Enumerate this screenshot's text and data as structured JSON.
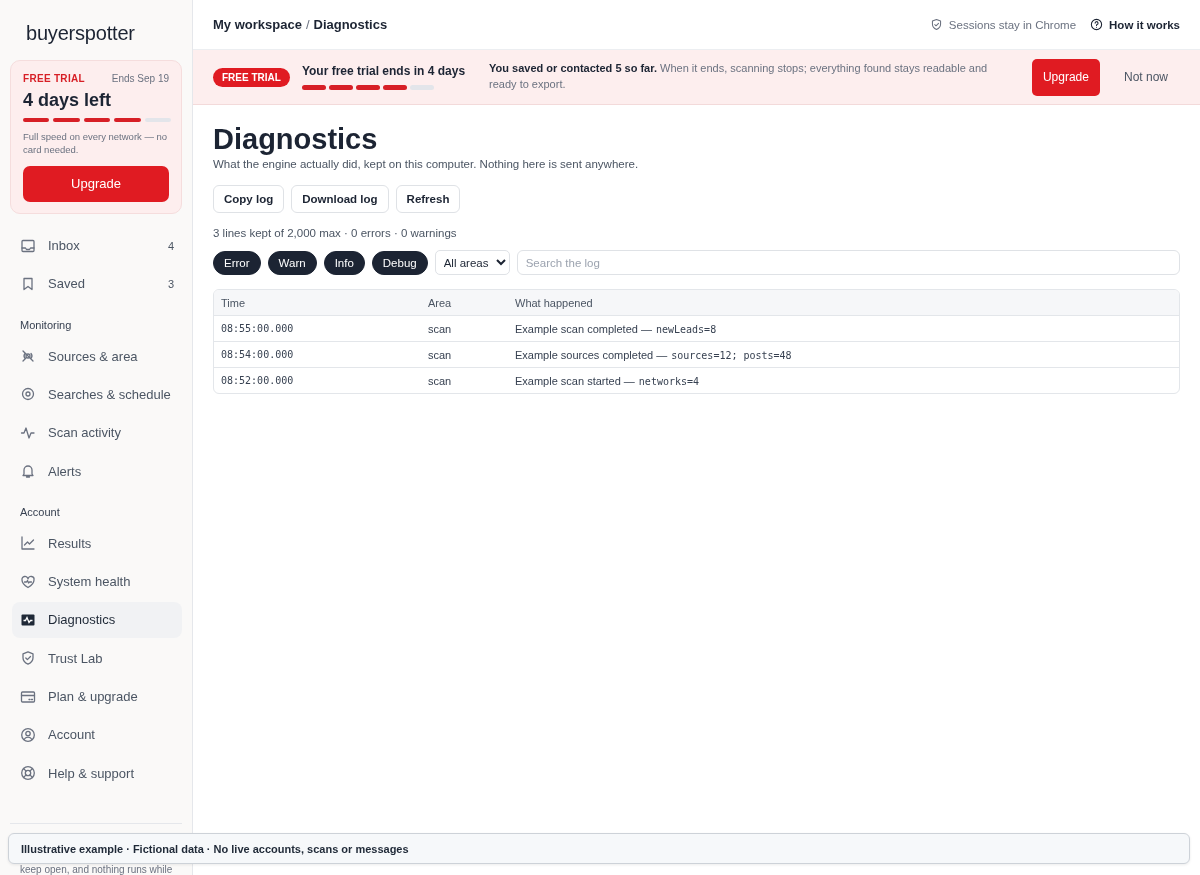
{
  "sidebar": {
    "logo": "buyerspotter",
    "trial_card": {
      "badge": "FREE TRIAL",
      "ends": "Ends Sep 19",
      "title": "4 days left",
      "level": 0.8,
      "note": "Full speed on every network — no card needed.",
      "button": "Upgrade"
    },
    "sections": [
      {
        "items": [
          {
            "label": "Inbox",
            "count": "4",
            "selected": false
          },
          {
            "label": "Saved",
            "count": "3",
            "selected": false
          }
        ]
      },
      {
        "heading": "Monitoring",
        "items": [
          {
            "label": "Sources & area",
            "selected": false
          },
          {
            "label": "Searches & schedule",
            "selected": false
          },
          {
            "label": "Scan activity",
            "selected": false
          },
          {
            "label": "Alerts",
            "selected": false
          }
        ]
      },
      {
        "heading": "Account",
        "items": [
          {
            "label": "Results",
            "selected": false
          },
          {
            "label": "System health",
            "selected": false
          },
          {
            "label": "Diagnostics",
            "selected": true
          },
          {
            "label": "Trust Lab",
            "selected": false
          },
          {
            "label": "Plan & upgrade",
            "selected": false
          },
          {
            "label": "Account",
            "selected": false
          },
          {
            "label": "Help & support",
            "selected": false
          }
        ]
      }
    ],
    "footer_text": "keep open, and nothing runs while"
  },
  "top_bar": {
    "breadcrumb": [
      "My workspace",
      "Diagnostics"
    ],
    "separator": "/",
    "session_note": "Sessions stay in Chrome",
    "help_link": "How it works"
  },
  "trial_banner": {
    "badge": "FREE TRIAL",
    "title": "Your free trial ends in 4 days",
    "level": 0.8,
    "message": "**You saved or contacted 5 so far.** When it ends, scanning stops; everything found stays readable and ready to export.",
    "upgrade": "Upgrade",
    "dismiss": "Not now"
  },
  "page": {
    "title": "Diagnostics",
    "subtitle": "What the engine actually did, kept on this computer. Nothing here is sent anywhere.",
    "actions": [
      "Copy log",
      "Download log",
      "Refresh"
    ],
    "stats": "3 lines kept of 2,000 max · 0 errors · 0 warnings",
    "filters": [
      {
        "label": "Error",
        "on": true
      },
      {
        "label": "Warn",
        "on": true
      },
      {
        "label": "Info",
        "on": true
      },
      {
        "label": "Debug",
        "on": true
      }
    ],
    "area_select": "All areas",
    "search": {
      "placeholder": "Search the log"
    },
    "table": {
      "columns": [
        "Time",
        "Area",
        "What happened"
      ],
      "rows": [
        {
          "time": "08:55:00.000",
          "area": "scan",
          "message": "Example scan completed —",
          "detail": "newLeads=8"
        },
        {
          "time": "08:54:00.000",
          "area": "scan",
          "message": "Example sources completed —",
          "detail": "sources=12; posts=48"
        },
        {
          "time": "08:52:00.000",
          "area": "scan",
          "message": "Example scan started —",
          "detail": "networks=4"
        }
      ]
    }
  },
  "demo_note": "Illustrative example · Fictional data · No live accounts, scans or messages"
}
